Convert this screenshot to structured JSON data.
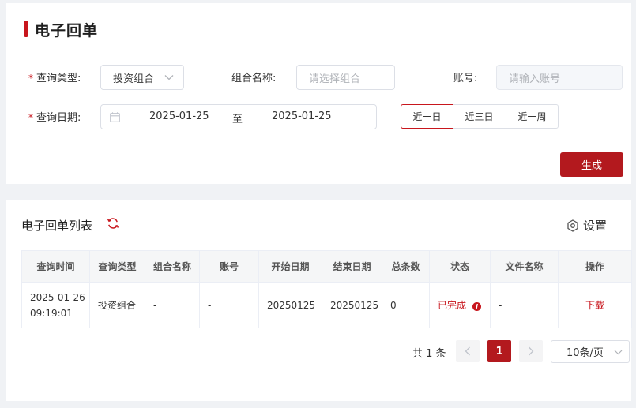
{
  "page": {
    "title": "电子回单"
  },
  "form": {
    "query_type": {
      "label": "查询类型:",
      "value": "投资组合"
    },
    "portfolio_name": {
      "label": "组合名称:",
      "placeholder": "请选择组合"
    },
    "account": {
      "label": "账号:",
      "placeholder": "请输入账号"
    },
    "query_date": {
      "label": "查询日期:",
      "start": "2025-01-25",
      "separator": "至",
      "end": "2025-01-25"
    },
    "quick_ranges": [
      "近一日",
      "近三日",
      "近一周"
    ],
    "active_range": "近一日",
    "generate_label": "生成"
  },
  "list": {
    "title": "电子回单列表",
    "settings_label": "设置",
    "columns": [
      "查询时间",
      "查询类型",
      "组合名称",
      "账号",
      "开始日期",
      "结束日期",
      "总条数",
      "状态",
      "文件名称",
      "操作"
    ],
    "rows": [
      {
        "query_time_date": "2025-01-26",
        "query_time_clock": "09:19:01",
        "query_type": "投资组合",
        "portfolio_name": "-",
        "account": "-",
        "start_date": "20250125",
        "end_date": "20250125",
        "total": "0",
        "status": "已完成",
        "file_name": "-",
        "action": "下载"
      }
    ]
  },
  "pagination": {
    "total_text": "共 1 条",
    "current_page": "1",
    "page_size": "10条/页"
  },
  "colors": {
    "accent": "#c8161d",
    "button": "#b3191e"
  }
}
